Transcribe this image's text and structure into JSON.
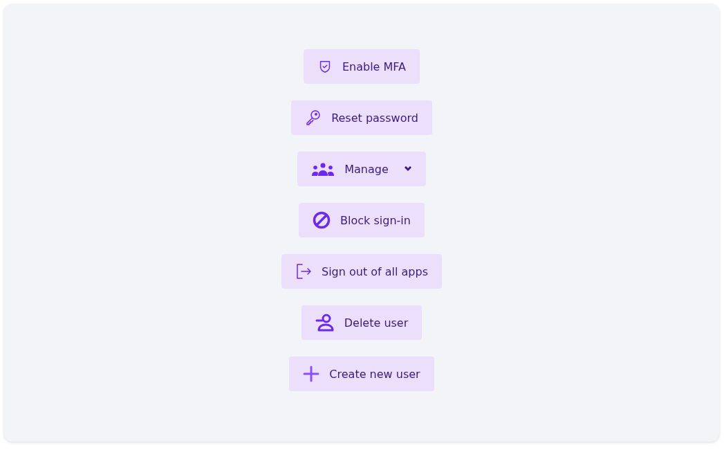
{
  "actions": [
    {
      "label": "Enable MFA",
      "kind": "shield",
      "dropdown": false
    },
    {
      "label": "Reset password",
      "kind": "key",
      "dropdown": false
    },
    {
      "label": "Manage",
      "kind": "group",
      "dropdown": true
    },
    {
      "label": "Block sign-in",
      "kind": "block",
      "dropdown": false
    },
    {
      "label": "Sign out of all apps",
      "kind": "signout",
      "dropdown": false
    },
    {
      "label": "Delete user",
      "kind": "remove-user",
      "dropdown": false
    },
    {
      "label": "Create new user",
      "kind": "plus",
      "dropdown": false
    }
  ]
}
